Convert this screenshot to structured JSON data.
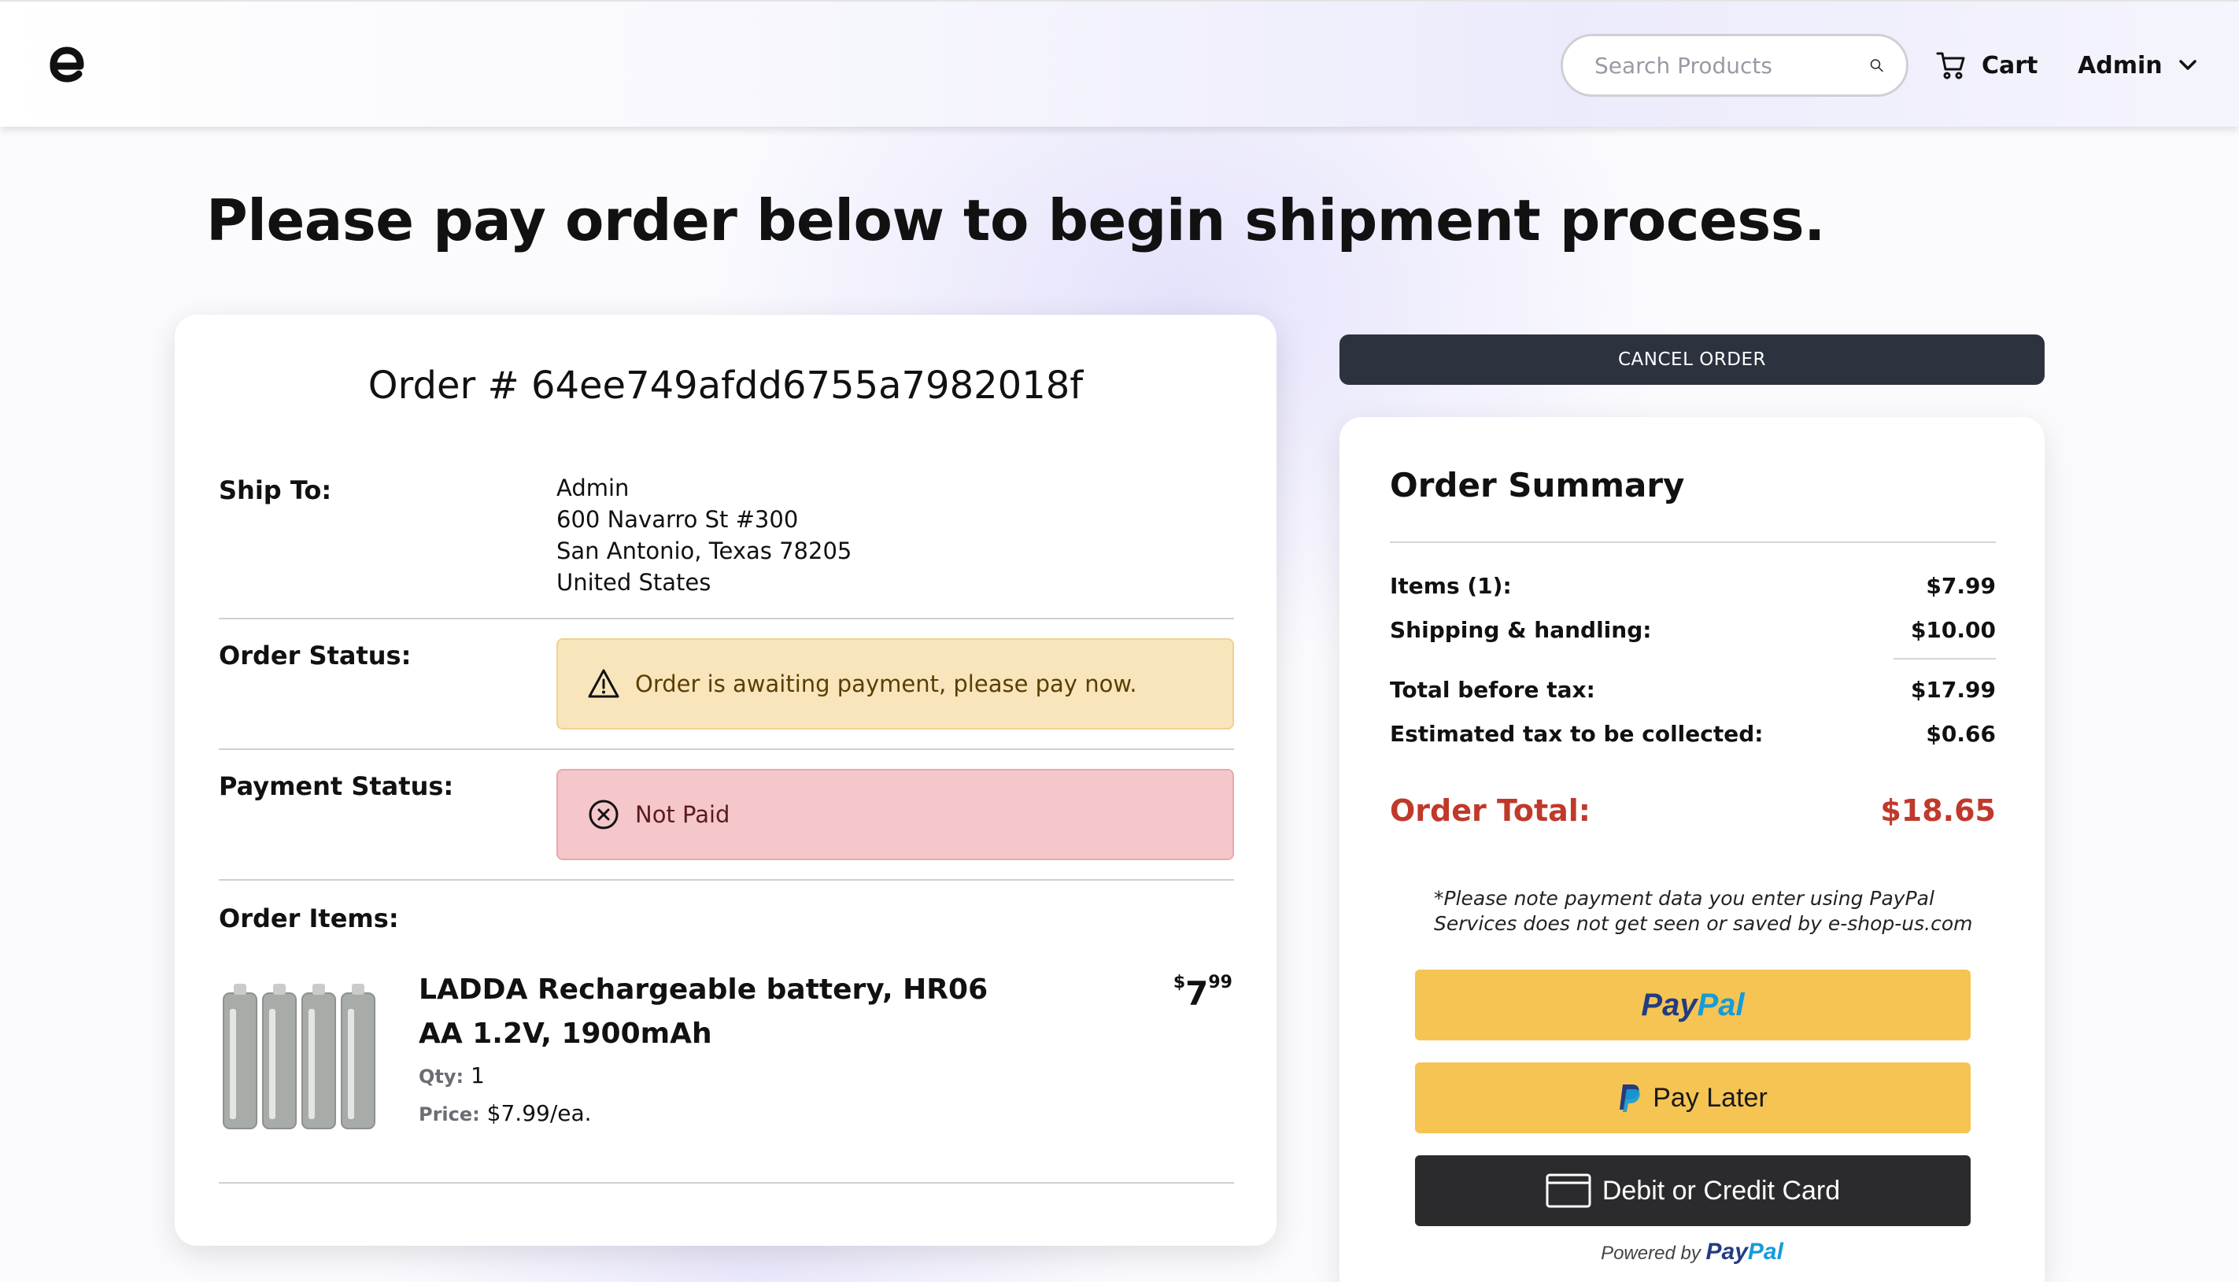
{
  "header": {
    "search_placeholder": "Search Products",
    "cart_label": "Cart",
    "user_label": "Admin"
  },
  "page_title": "Please pay order below to begin shipment process.",
  "order": {
    "id_text": "Order # 64ee749afdd6755a7982018f",
    "ship_to_label": "Ship To:",
    "address": [
      "Admin",
      "600 Navarro St #300",
      "San Antonio, Texas 78205",
      "United States"
    ],
    "order_status_label": "Order Status:",
    "order_status_text": "Order is awaiting payment, please pay now.",
    "payment_status_label": "Payment Status:",
    "payment_status_text": "Not Paid",
    "items_label": "Order Items:",
    "items": [
      {
        "name": "LADDA Rechargeable battery, HR06 AA 1.2V, 1900mAh",
        "qty_label": "Qty:",
        "qty": "1",
        "price_label": "Price:",
        "price_each": "$7.99/ea.",
        "price_currency": "$",
        "price_whole": "7",
        "price_cents": "99"
      }
    ]
  },
  "actions": {
    "cancel_label": "CANCEL ORDER"
  },
  "summary": {
    "title": "Order Summary",
    "items_label": "Items (1):",
    "items_value": "$7.99",
    "shipping_label": "Shipping & handling:",
    "shipping_value": "$10.00",
    "before_tax_label": "Total before tax:",
    "before_tax_value": "$17.99",
    "tax_label": "Estimated tax to be collected:",
    "tax_value": "$0.66",
    "total_label": "Order Total:",
    "total_value": "$18.65",
    "note_line1": "*Please note payment data you enter using PayPal",
    "note_line2": "Services does not get seen or saved by e-shop-us.com"
  },
  "paypal": {
    "brand_part1": "Pay",
    "brand_part2": "Pal",
    "pay_later_label": "Pay Later",
    "card_label": "Debit or Credit Card",
    "powered_by": "Powered by"
  },
  "colors": {
    "total_red": "#c0392b",
    "paypal_yellow": "#f5c453",
    "warn_bg": "#f8e5bc",
    "danger_bg": "#f5c7ca",
    "dark_button": "#2d323f"
  }
}
